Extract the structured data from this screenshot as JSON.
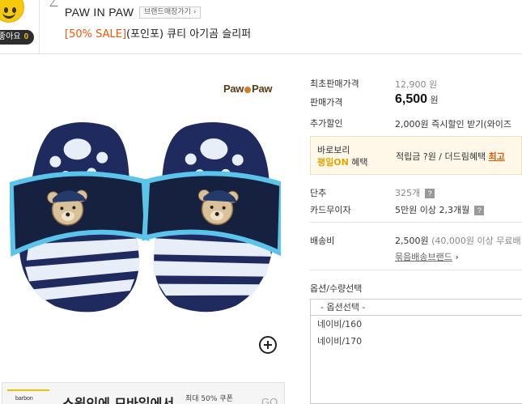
{
  "header": {
    "like_label": "좋아요",
    "like_count": "0",
    "brand_name": "PAW IN PAW",
    "brand_shop_button": "브랜드매장가기 ›",
    "title_sale": "[50% SALE]",
    "title_rest": "(포인포) 큐티 아기곰 슬리퍼"
  },
  "product_image": {
    "brand_logo_left": "Paw",
    "brand_logo_right": "Paw"
  },
  "banner": {
    "logo_text": "barbon",
    "text": "스윗인에 모바일에서",
    "sub": "최대 50% 쿠폰",
    "go": "GO"
  },
  "price": {
    "first_price_label": "최초판매가격",
    "first_price_value": "12,900 원",
    "sale_price_label": "판매가격",
    "sale_price_value": "6,500",
    "sale_price_unit": "원",
    "extra_discount_label": "추가할인",
    "extra_discount_value": "2,000원 즉시할인 받기(와이즈"
  },
  "promo": {
    "line1": "바로보리",
    "line2_hl": "평일ON",
    "line2_rest": " 혜택",
    "points_text": "적립금 ?원 / 더드림혜택 ",
    "points_link": "최고"
  },
  "details": {
    "unit_label": "단추",
    "unit_value": "325개",
    "card_label": "카드무이자",
    "card_value": "5만원 이상 2,3개월",
    "shipping_label": "배송비",
    "shipping_value": "2,500원",
    "shipping_note": " (40,000원 이상 무료배",
    "bundle_link": "묶음배송브랜드",
    "bundle_arrow": " ›"
  },
  "options": {
    "label": "옵션/수량선택",
    "placeholder": "- 옵션선택 -",
    "items": [
      "네이비/160",
      "네이비/170"
    ]
  }
}
